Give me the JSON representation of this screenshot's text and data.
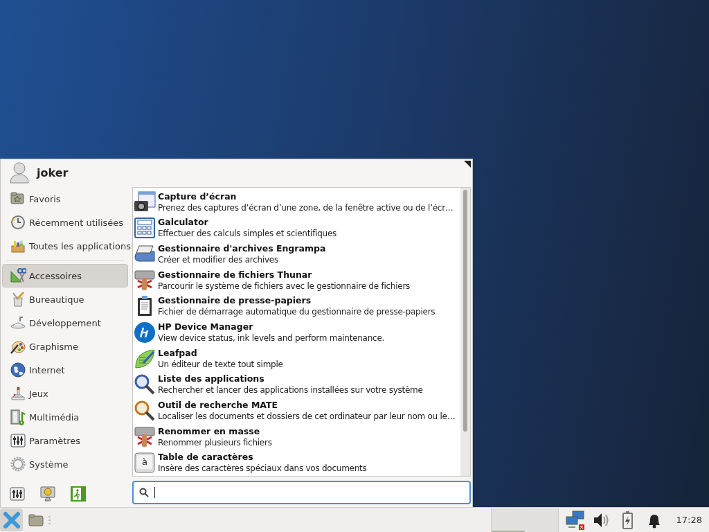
{
  "user": {
    "name": "joker"
  },
  "places": [
    {
      "label": "Favoris",
      "selected": false
    },
    {
      "label": "Récemment utilisées",
      "selected": false
    },
    {
      "label": "Toutes les applications",
      "selected": false
    }
  ],
  "categories": [
    {
      "label": "Accessoires",
      "selected": true
    },
    {
      "label": "Bureautique",
      "selected": false
    },
    {
      "label": "Développement",
      "selected": false
    },
    {
      "label": "Graphisme",
      "selected": false
    },
    {
      "label": "Internet",
      "selected": false
    },
    {
      "label": "Jeux",
      "selected": false
    },
    {
      "label": "Multimédia",
      "selected": false
    },
    {
      "label": "Paramètres",
      "selected": false
    },
    {
      "label": "Système",
      "selected": false
    }
  ],
  "apps": [
    {
      "name": "Capture d’écran",
      "description": "Prenez des captures d’écran d’une zone, de la fenêtre active ou de l’écr…"
    },
    {
      "name": "Galculator",
      "description": "Effectuer des calculs simples et scientifiques"
    },
    {
      "name": "Gestionnaire d'archives Engrampa",
      "description": "Créer et modifier des archives"
    },
    {
      "name": "Gestionnaire de fichiers Thunar",
      "description": "Parcourir le système de fichiers avec le gestionnaire de fichiers"
    },
    {
      "name": "Gestionnaire de presse-papiers",
      "description": "Fichier de démarrage automatique du gestionnaire de presse-papiers"
    },
    {
      "name": "HP Device Manager",
      "description": "View device status, ink levels and perform maintenance."
    },
    {
      "name": "Leafpad",
      "description": "Un éditeur de texte tout simple"
    },
    {
      "name": "Liste des applications",
      "description": "Rechercher et lancer des applications installées sur votre système"
    },
    {
      "name": "Outil de recherche MATE",
      "description": "Localiser les documents et dossiers de cet ordinateur par leur nom ou le…"
    },
    {
      "name": "Renommer en masse",
      "description": "Renommer plusieurs fichiers"
    },
    {
      "name": "Table de caractères",
      "description": "Insère des caractères spéciaux dans vos documents",
      "glyph": "à"
    }
  ],
  "taskbar": {
    "clock": "17:28"
  }
}
